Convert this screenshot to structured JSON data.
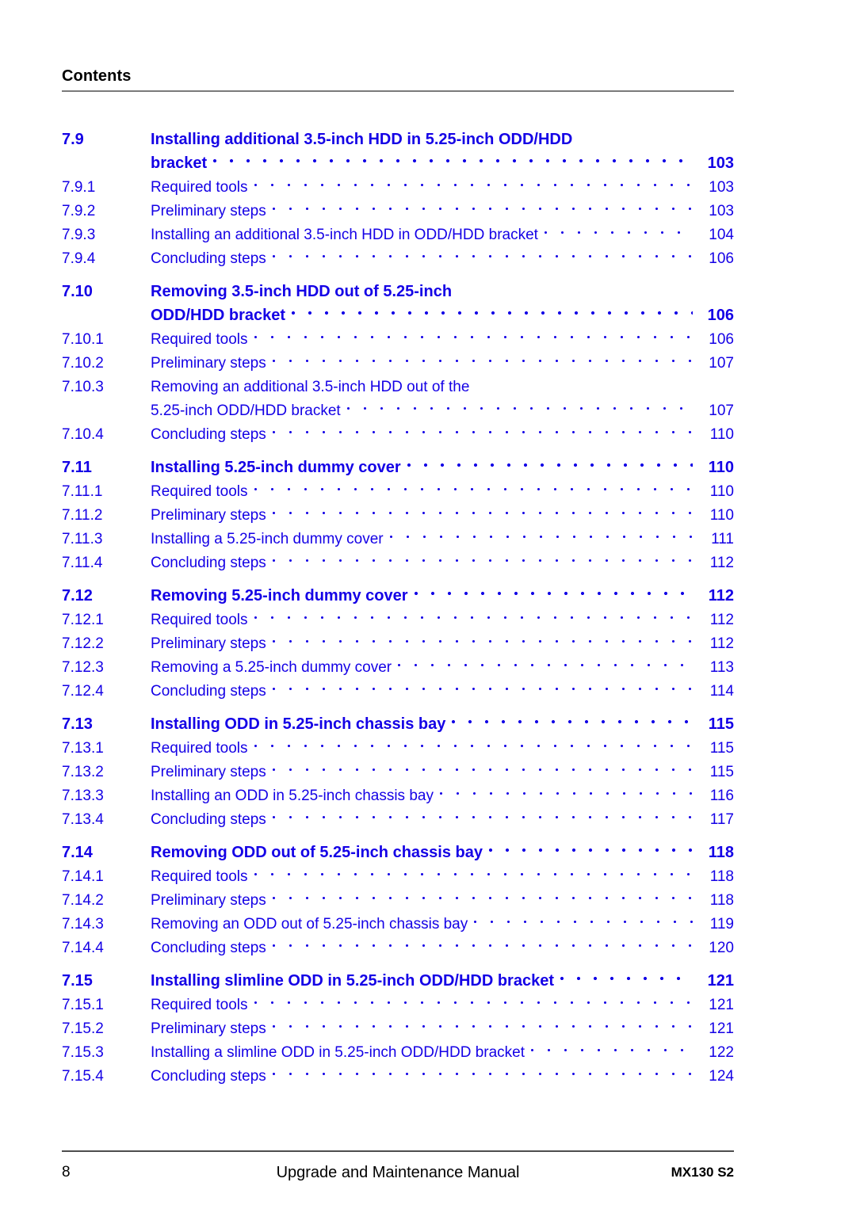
{
  "header": {
    "title": "Contents"
  },
  "colors": {
    "entry_blue": "#1400e6",
    "header_rule": "#7a7a7a",
    "footer_rule": "#4d4d4d",
    "text_black": "#000000"
  },
  "toc": {
    "entries": [
      {
        "number": "7.9",
        "level": "major",
        "gap_before": false,
        "lines": [
          "Installing additional 3.5-inch HDD in 5.25-inch ODD/HDD",
          "bracket"
        ],
        "page": "103"
      },
      {
        "number": "7.9.1",
        "level": "sub",
        "gap_before": false,
        "lines": [
          "Required tools"
        ],
        "page": "103"
      },
      {
        "number": "7.9.2",
        "level": "sub",
        "gap_before": false,
        "lines": [
          "Preliminary steps"
        ],
        "page": "103"
      },
      {
        "number": "7.9.3",
        "level": "sub",
        "gap_before": false,
        "lines": [
          "Installing an additional 3.5-inch HDD in ODD/HDD bracket"
        ],
        "page": "104"
      },
      {
        "number": "7.9.4",
        "level": "sub",
        "gap_before": false,
        "lines": [
          "Concluding steps"
        ],
        "page": "106"
      },
      {
        "number": "7.10",
        "level": "major",
        "gap_before": true,
        "lines": [
          "Removing 3.5-inch HDD out of 5.25-inch",
          "ODD/HDD bracket"
        ],
        "page": "106"
      },
      {
        "number": "7.10.1",
        "level": "sub",
        "gap_before": false,
        "lines": [
          "Required tools"
        ],
        "page": "106"
      },
      {
        "number": "7.10.2",
        "level": "sub",
        "gap_before": false,
        "lines": [
          "Preliminary steps"
        ],
        "page": "107"
      },
      {
        "number": "7.10.3",
        "level": "sub",
        "gap_before": false,
        "lines": [
          "Removing an additional 3.5-inch HDD out of the",
          "5.25-inch ODD/HDD bracket"
        ],
        "page": "107"
      },
      {
        "number": "7.10.4",
        "level": "sub",
        "gap_before": false,
        "lines": [
          "Concluding steps"
        ],
        "page": "110"
      },
      {
        "number": "7.11",
        "level": "major",
        "gap_before": true,
        "lines": [
          "Installing 5.25-inch dummy cover"
        ],
        "page": "110"
      },
      {
        "number": "7.11.1",
        "level": "sub",
        "gap_before": false,
        "lines": [
          "Required tools"
        ],
        "page": "110"
      },
      {
        "number": "7.11.2",
        "level": "sub",
        "gap_before": false,
        "lines": [
          "Preliminary steps"
        ],
        "page": "110"
      },
      {
        "number": "7.11.3",
        "level": "sub",
        "gap_before": false,
        "lines": [
          "Installing a 5.25-inch dummy cover"
        ],
        "page": "111"
      },
      {
        "number": "7.11.4",
        "level": "sub",
        "gap_before": false,
        "lines": [
          "Concluding steps"
        ],
        "page": "112"
      },
      {
        "number": "7.12",
        "level": "major",
        "gap_before": true,
        "lines": [
          "Removing 5.25-inch dummy cover"
        ],
        "page": "112"
      },
      {
        "number": "7.12.1",
        "level": "sub",
        "gap_before": false,
        "lines": [
          "Required tools"
        ],
        "page": "112"
      },
      {
        "number": "7.12.2",
        "level": "sub",
        "gap_before": false,
        "lines": [
          "Preliminary steps"
        ],
        "page": "112"
      },
      {
        "number": "7.12.3",
        "level": "sub",
        "gap_before": false,
        "lines": [
          "Removing a 5.25-inch dummy cover"
        ],
        "page": "113"
      },
      {
        "number": "7.12.4",
        "level": "sub",
        "gap_before": false,
        "lines": [
          "Concluding steps"
        ],
        "page": "114"
      },
      {
        "number": "7.13",
        "level": "major",
        "gap_before": true,
        "lines": [
          "Installing ODD in 5.25-inch chassis bay"
        ],
        "page": "115"
      },
      {
        "number": "7.13.1",
        "level": "sub",
        "gap_before": false,
        "lines": [
          "Required tools"
        ],
        "page": "115"
      },
      {
        "number": "7.13.2",
        "level": "sub",
        "gap_before": false,
        "lines": [
          "Preliminary steps"
        ],
        "page": "115"
      },
      {
        "number": "7.13.3",
        "level": "sub",
        "gap_before": false,
        "lines": [
          "Installing an ODD in 5.25-inch chassis bay"
        ],
        "page": "116"
      },
      {
        "number": "7.13.4",
        "level": "sub",
        "gap_before": false,
        "lines": [
          "Concluding steps"
        ],
        "page": "117"
      },
      {
        "number": "7.14",
        "level": "major",
        "gap_before": true,
        "lines": [
          "Removing ODD out of 5.25-inch chassis bay"
        ],
        "page": "118"
      },
      {
        "number": "7.14.1",
        "level": "sub",
        "gap_before": false,
        "lines": [
          "Required tools"
        ],
        "page": "118"
      },
      {
        "number": "7.14.2",
        "level": "sub",
        "gap_before": false,
        "lines": [
          "Preliminary steps"
        ],
        "page": "118"
      },
      {
        "number": "7.14.3",
        "level": "sub",
        "gap_before": false,
        "lines": [
          "Removing an ODD out of 5.25-inch chassis bay"
        ],
        "page": "119"
      },
      {
        "number": "7.14.4",
        "level": "sub",
        "gap_before": false,
        "lines": [
          "Concluding steps"
        ],
        "page": "120"
      },
      {
        "number": "7.15",
        "level": "major",
        "gap_before": true,
        "lines": [
          "Installing slimline ODD in 5.25-inch ODD/HDD bracket"
        ],
        "page": "121"
      },
      {
        "number": "7.15.1",
        "level": "sub",
        "gap_before": false,
        "lines": [
          "Required tools"
        ],
        "page": "121"
      },
      {
        "number": "7.15.2",
        "level": "sub",
        "gap_before": false,
        "lines": [
          "Preliminary steps"
        ],
        "page": "121"
      },
      {
        "number": "7.15.3",
        "level": "sub",
        "gap_before": false,
        "lines": [
          "Installing a slimline ODD in 5.25-inch ODD/HDD bracket"
        ],
        "page": "122"
      },
      {
        "number": "7.15.4",
        "level": "sub",
        "gap_before": false,
        "lines": [
          "Concluding steps"
        ],
        "page": "124"
      }
    ]
  },
  "footer": {
    "page_number": "8",
    "document_title": "Upgrade and Maintenance Manual",
    "product": "MX130 S2"
  }
}
